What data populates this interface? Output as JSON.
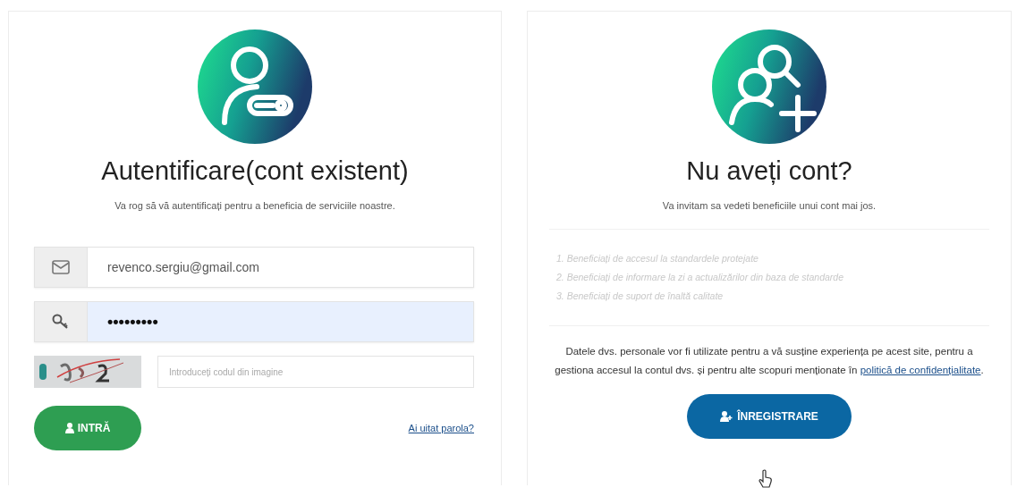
{
  "login": {
    "title": "Autentificare(cont existent)",
    "subtitle": "Va rog să vă autentificați pentru a beneficia de serviciile noastre.",
    "email": {
      "value": "revenco.sergiu@gmail.com",
      "focused": false
    },
    "password": {
      "value": "•••••••••",
      "focused": true
    },
    "captcha": {
      "kind": "picture",
      "placeholder": "Introduceți codul din imagine"
    },
    "submit": "INTRĂ",
    "forgot_link": "Ai uitat parola?"
  },
  "register": {
    "title": "Nu aveți cont?",
    "subtitle": "Va invitam sa vedeti beneficiile unui cont mai jos.",
    "benefits": [
      "1. Beneficiați de accesul la standardele protejate",
      "2. Beneficiați de informare la zi a actualizărilor din baza de standarde",
      "3. Beneficiați de suport de înaltă calitate"
    ],
    "notice": "Datele dvs. personale vor fi utilizate pentru a vă susține experiența pe acest site, pentru a gestiona accesul la contul dvs. și pentru alte scopuri menționate în ",
    "policy_link": "politică de confidențialitate",
    "notice_end": ".",
    "button": "ÎNREGISTRARE"
  }
}
